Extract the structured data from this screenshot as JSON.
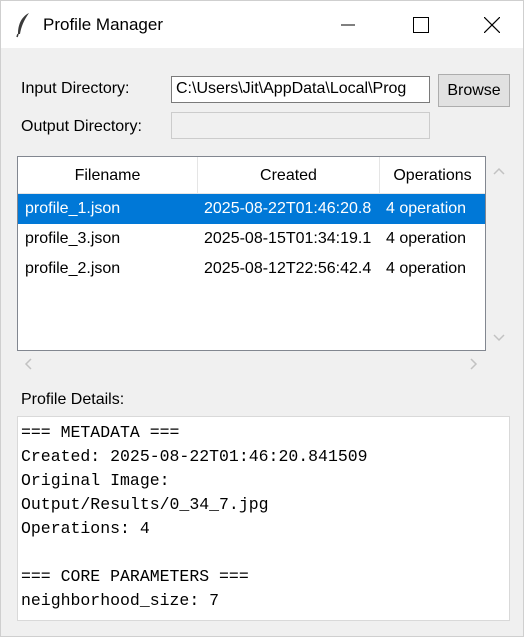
{
  "window": {
    "title": "Profile Manager"
  },
  "form": {
    "input_label": "Input Directory:",
    "input_value": "C:\\Users\\Jit\\AppData\\Local\\Prog",
    "browse_label": "Browse",
    "output_label": "Output Directory:",
    "output_value": ""
  },
  "table": {
    "columns": [
      "Filename",
      "Created",
      "Operations"
    ],
    "rows": [
      {
        "filename": "profile_1.json",
        "created": "2025-08-22T01:46:20.8",
        "operations": "4 operation",
        "selected": true
      },
      {
        "filename": "profile_3.json",
        "created": "2025-08-15T01:34:19.1",
        "operations": "4 operation",
        "selected": false
      },
      {
        "filename": "profile_2.json",
        "created": "2025-08-12T22:56:42.4",
        "operations": "4 operation",
        "selected": false
      }
    ]
  },
  "details": {
    "label": "Profile Details:",
    "lines": [
      "=== METADATA ===",
      "Created: 2025-08-22T01:46:20.841509",
      "Original Image:",
      "Output/Results/0_34_7.jpg",
      "Operations: 4",
      "",
      "=== CORE PARAMETERS ===",
      "neighborhood_size: 7"
    ]
  },
  "colors": {
    "selection": "#0078d7",
    "window_bg": "#f0f0f0"
  }
}
